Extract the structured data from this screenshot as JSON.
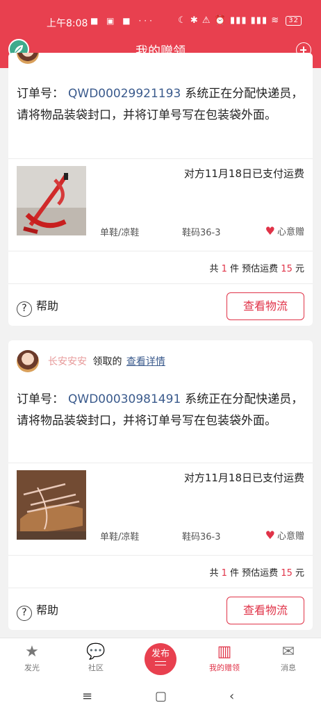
{
  "status_bar": {
    "time": "上午8:08",
    "indicators": "■ ▣ ■ ···",
    "right": "☾ ✱ ⚠ ⏰ ▮▮▮ ▮▮▮ ≋",
    "battery": "32"
  },
  "header": {
    "title": "我的赠领",
    "logo_icon": "leaf-logo",
    "add_icon": "plus-circle-icon"
  },
  "cards": [
    {
      "claimer_name": "",
      "claim_verb": "",
      "detail_link": "",
      "order_label": "订单号：",
      "order_no": "QWD00029921193",
      "message": "系统正在分配快递员，请将物品装袋封口，并将订单号写在包装袋外面。",
      "paid": "对方11月18日已支付运费",
      "category": "单鞋/凉鞋",
      "size": "鞋码36-3",
      "gift_tag": "心意赠",
      "total_prefix": "共",
      "count": "1",
      "total_mid": "件 预估运费",
      "fee": "15",
      "total_suffix": "元",
      "help": "帮助",
      "track": "查看物流"
    },
    {
      "claimer_name": "长安安安",
      "claim_verb": "领取的",
      "detail_link": "查看详情",
      "order_label": "订单号：",
      "order_no": "QWD00030981491",
      "message": "系统正在分配快递员，请将物品装袋封口，并将订单号写在包装袋外面。",
      "paid": "对方11月18日已支付运费",
      "category": "单鞋/凉鞋",
      "size": "鞋码36-3",
      "gift_tag": "心意赠",
      "total_prefix": "共",
      "count": "1",
      "total_mid": "件 预估运费",
      "fee": "15",
      "total_suffix": "元",
      "help": "帮助",
      "track": "查看物流"
    }
  ],
  "tabbar": {
    "tabs": [
      {
        "label": "发光",
        "icon": "star-icon"
      },
      {
        "label": "社区",
        "icon": "chat-bubble-icon"
      },
      {
        "label": "我的赠领",
        "icon": "gift-box-icon"
      },
      {
        "label": "消息",
        "icon": "mail-icon"
      }
    ],
    "publish": "发布"
  },
  "colors": {
    "brand": "#e8404f",
    "accent": "#e03348",
    "link": "#3a5a8c"
  }
}
